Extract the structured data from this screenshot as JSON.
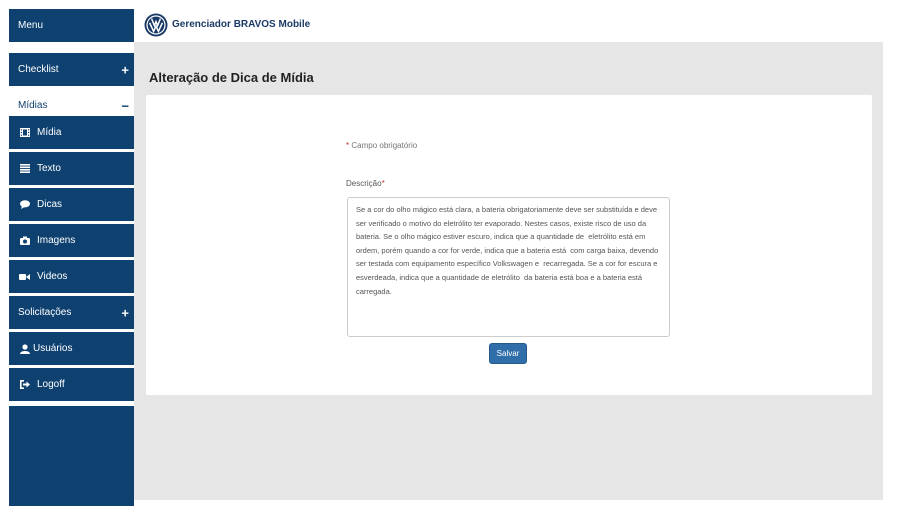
{
  "header": {
    "app_title": "Gerenciador BRAVOS Mobile"
  },
  "sidebar": {
    "items": [
      {
        "label": "Menu",
        "icon": "",
        "sign": ""
      },
      {
        "label": "Checklist",
        "icon": "",
        "sign": "+"
      },
      {
        "label": "Mídias",
        "icon": "",
        "sign": "−"
      },
      {
        "label": "Mídia",
        "icon": "film-icon",
        "sign": ""
      },
      {
        "label": "Texto",
        "icon": "list-icon",
        "sign": ""
      },
      {
        "label": "Dicas",
        "icon": "comment-icon",
        "sign": ""
      },
      {
        "label": "Imagens",
        "icon": "camera-icon",
        "sign": ""
      },
      {
        "label": "Videos",
        "icon": "video-camera-icon",
        "sign": ""
      },
      {
        "label": "Solicitações",
        "icon": "",
        "sign": "+"
      },
      {
        "label": "Usuários",
        "icon": "user-icon",
        "sign": ""
      },
      {
        "label": "Logoff",
        "icon": "logout-icon",
        "sign": ""
      }
    ]
  },
  "main": {
    "page_title": "Alteração de Dica de Mídia",
    "required_star": "*",
    "required_note": "Campo obrigatório",
    "description_label": "Descrição",
    "description_value": "Se a cor do olho mágico está clara, a bateria obrigatoriamente deve ser substituída e deve ser verificado o motivo do eletrólito ter evaporado. Nestes casos, existe risco de uso da bateria. Se o olho mágico estiver escuro, indica que a quantidade de  eletrólito está em ordem, porém quando a cor for verde, indica que a bateria está  com carga baixa, devendo ser testada com equipamento específico Volkswagen e  recarregada. Se a cor for escura e esverdeada, indica que a quantidade de eletrólito  da bateria está boa e a bateria está carregada.",
    "save_label": "Salvar"
  },
  "colors": {
    "sidebar_bg": "#0f4170",
    "content_bg": "#e6e6e6",
    "button_bg": "#2f6ea8",
    "required_star": "#c0392b"
  }
}
